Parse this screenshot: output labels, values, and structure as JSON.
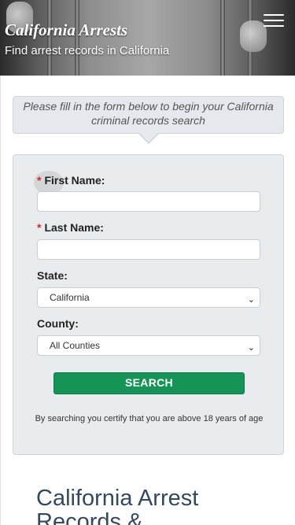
{
  "header": {
    "title": "California Arrests",
    "subtitle": "Find arrest records in California",
    "menu_icon": "hamburger-icon"
  },
  "intro": {
    "text": "Please fill in the form below to begin your California criminal records search"
  },
  "form": {
    "first_name_label": "First Name:",
    "last_name_label": "Last Name:",
    "required_marker": "*",
    "first_name_value": "",
    "last_name_value": "",
    "state_label": "State:",
    "state_selected": "California",
    "county_label": "County:",
    "county_selected": "All Counties",
    "search_label": "SEARCH",
    "certify_text": "By searching you certify that you are above 18 years of age"
  },
  "section": {
    "title_partial": "California Arrest Records &"
  },
  "colors": {
    "accent": "#169457",
    "required": "#d9242b",
    "heading": "#34495e"
  }
}
